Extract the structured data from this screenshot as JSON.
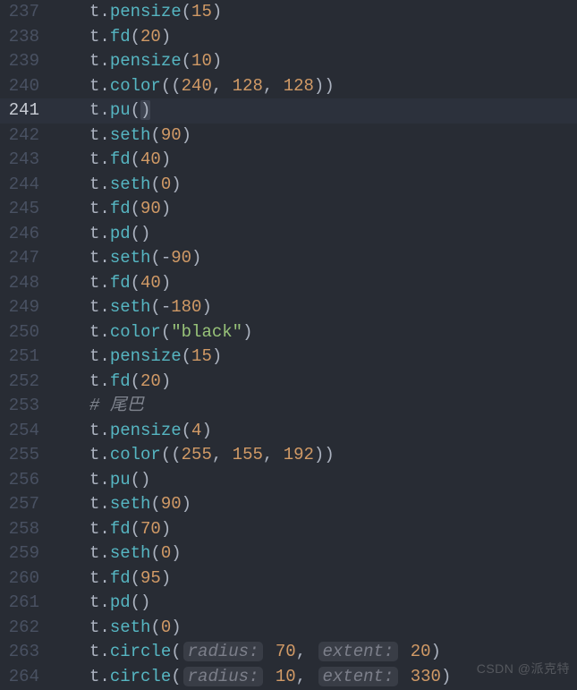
{
  "editor": {
    "watermark": "CSDN @派克特",
    "active_line": 241,
    "lines": [
      {
        "num": 237,
        "tokens": [
          {
            "t": "ident",
            "v": "t"
          },
          {
            "t": "punc",
            "v": "."
          },
          {
            "t": "func",
            "v": "pensize"
          },
          {
            "t": "punc",
            "v": "("
          },
          {
            "t": "num",
            "v": "15"
          },
          {
            "t": "punc",
            "v": ")"
          }
        ]
      },
      {
        "num": 238,
        "tokens": [
          {
            "t": "ident",
            "v": "t"
          },
          {
            "t": "punc",
            "v": "."
          },
          {
            "t": "func",
            "v": "fd"
          },
          {
            "t": "punc",
            "v": "("
          },
          {
            "t": "num",
            "v": "20"
          },
          {
            "t": "punc",
            "v": ")"
          }
        ]
      },
      {
        "num": 239,
        "tokens": [
          {
            "t": "ident",
            "v": "t"
          },
          {
            "t": "punc",
            "v": "."
          },
          {
            "t": "func",
            "v": "pensize"
          },
          {
            "t": "punc",
            "v": "("
          },
          {
            "t": "num",
            "v": "10"
          },
          {
            "t": "punc",
            "v": ")"
          }
        ]
      },
      {
        "num": 240,
        "tokens": [
          {
            "t": "ident",
            "v": "t"
          },
          {
            "t": "punc",
            "v": "."
          },
          {
            "t": "func",
            "v": "color"
          },
          {
            "t": "punc",
            "v": "(("
          },
          {
            "t": "num",
            "v": "240"
          },
          {
            "t": "punc",
            "v": ", "
          },
          {
            "t": "num",
            "v": "128"
          },
          {
            "t": "punc",
            "v": ", "
          },
          {
            "t": "num",
            "v": "128"
          },
          {
            "t": "punc",
            "v": "))"
          }
        ]
      },
      {
        "num": 241,
        "tokens": [
          {
            "t": "ident",
            "v": "t"
          },
          {
            "t": "punc",
            "v": "."
          },
          {
            "t": "func",
            "v": "pu"
          },
          {
            "t": "punc",
            "v": "("
          },
          {
            "t": "punc",
            "v": ")",
            "cursor": true
          }
        ]
      },
      {
        "num": 242,
        "tokens": [
          {
            "t": "ident",
            "v": "t"
          },
          {
            "t": "punc",
            "v": "."
          },
          {
            "t": "func",
            "v": "seth"
          },
          {
            "t": "punc",
            "v": "("
          },
          {
            "t": "num",
            "v": "90"
          },
          {
            "t": "punc",
            "v": ")"
          }
        ]
      },
      {
        "num": 243,
        "tokens": [
          {
            "t": "ident",
            "v": "t"
          },
          {
            "t": "punc",
            "v": "."
          },
          {
            "t": "func",
            "v": "fd"
          },
          {
            "t": "punc",
            "v": "("
          },
          {
            "t": "num",
            "v": "40"
          },
          {
            "t": "punc",
            "v": ")"
          }
        ]
      },
      {
        "num": 244,
        "tokens": [
          {
            "t": "ident",
            "v": "t"
          },
          {
            "t": "punc",
            "v": "."
          },
          {
            "t": "func",
            "v": "seth"
          },
          {
            "t": "punc",
            "v": "("
          },
          {
            "t": "num",
            "v": "0"
          },
          {
            "t": "punc",
            "v": ")"
          }
        ]
      },
      {
        "num": 245,
        "tokens": [
          {
            "t": "ident",
            "v": "t"
          },
          {
            "t": "punc",
            "v": "."
          },
          {
            "t": "func",
            "v": "fd"
          },
          {
            "t": "punc",
            "v": "("
          },
          {
            "t": "num",
            "v": "90"
          },
          {
            "t": "punc",
            "v": ")"
          }
        ]
      },
      {
        "num": 246,
        "tokens": [
          {
            "t": "ident",
            "v": "t"
          },
          {
            "t": "punc",
            "v": "."
          },
          {
            "t": "func",
            "v": "pd"
          },
          {
            "t": "punc",
            "v": "()"
          }
        ]
      },
      {
        "num": 247,
        "tokens": [
          {
            "t": "ident",
            "v": "t"
          },
          {
            "t": "punc",
            "v": "."
          },
          {
            "t": "func",
            "v": "seth"
          },
          {
            "t": "punc",
            "v": "(-"
          },
          {
            "t": "num",
            "v": "90"
          },
          {
            "t": "punc",
            "v": ")"
          }
        ]
      },
      {
        "num": 248,
        "tokens": [
          {
            "t": "ident",
            "v": "t"
          },
          {
            "t": "punc",
            "v": "."
          },
          {
            "t": "func",
            "v": "fd"
          },
          {
            "t": "punc",
            "v": "("
          },
          {
            "t": "num",
            "v": "40"
          },
          {
            "t": "punc",
            "v": ")"
          }
        ]
      },
      {
        "num": 249,
        "tokens": [
          {
            "t": "ident",
            "v": "t"
          },
          {
            "t": "punc",
            "v": "."
          },
          {
            "t": "func",
            "v": "seth"
          },
          {
            "t": "punc",
            "v": "(-"
          },
          {
            "t": "num",
            "v": "180"
          },
          {
            "t": "punc",
            "v": ")"
          }
        ]
      },
      {
        "num": 250,
        "tokens": [
          {
            "t": "ident",
            "v": "t"
          },
          {
            "t": "punc",
            "v": "."
          },
          {
            "t": "func",
            "v": "color"
          },
          {
            "t": "punc",
            "v": "("
          },
          {
            "t": "str",
            "v": "\"black\""
          },
          {
            "t": "punc",
            "v": ")"
          }
        ]
      },
      {
        "num": 251,
        "tokens": [
          {
            "t": "ident",
            "v": "t"
          },
          {
            "t": "punc",
            "v": "."
          },
          {
            "t": "func",
            "v": "pensize"
          },
          {
            "t": "punc",
            "v": "("
          },
          {
            "t": "num",
            "v": "15"
          },
          {
            "t": "punc",
            "v": ")"
          }
        ]
      },
      {
        "num": 252,
        "tokens": [
          {
            "t": "ident",
            "v": "t"
          },
          {
            "t": "punc",
            "v": "."
          },
          {
            "t": "func",
            "v": "fd"
          },
          {
            "t": "punc",
            "v": "("
          },
          {
            "t": "num",
            "v": "20"
          },
          {
            "t": "punc",
            "v": ")"
          }
        ]
      },
      {
        "num": 253,
        "tokens": [
          {
            "t": "cmt",
            "v": "# 尾巴"
          }
        ]
      },
      {
        "num": 254,
        "tokens": [
          {
            "t": "ident",
            "v": "t"
          },
          {
            "t": "punc",
            "v": "."
          },
          {
            "t": "func",
            "v": "pensize"
          },
          {
            "t": "punc",
            "v": "("
          },
          {
            "t": "num",
            "v": "4"
          },
          {
            "t": "punc",
            "v": ")"
          }
        ]
      },
      {
        "num": 255,
        "tokens": [
          {
            "t": "ident",
            "v": "t"
          },
          {
            "t": "punc",
            "v": "."
          },
          {
            "t": "func",
            "v": "color"
          },
          {
            "t": "punc",
            "v": "(("
          },
          {
            "t": "num",
            "v": "255"
          },
          {
            "t": "punc",
            "v": ", "
          },
          {
            "t": "num",
            "v": "155"
          },
          {
            "t": "punc",
            "v": ", "
          },
          {
            "t": "num",
            "v": "192"
          },
          {
            "t": "punc",
            "v": "))"
          }
        ]
      },
      {
        "num": 256,
        "tokens": [
          {
            "t": "ident",
            "v": "t"
          },
          {
            "t": "punc",
            "v": "."
          },
          {
            "t": "func",
            "v": "pu"
          },
          {
            "t": "punc",
            "v": "()"
          }
        ]
      },
      {
        "num": 257,
        "tokens": [
          {
            "t": "ident",
            "v": "t"
          },
          {
            "t": "punc",
            "v": "."
          },
          {
            "t": "func",
            "v": "seth"
          },
          {
            "t": "punc",
            "v": "("
          },
          {
            "t": "num",
            "v": "90"
          },
          {
            "t": "punc",
            "v": ")"
          }
        ]
      },
      {
        "num": 258,
        "tokens": [
          {
            "t": "ident",
            "v": "t"
          },
          {
            "t": "punc",
            "v": "."
          },
          {
            "t": "func",
            "v": "fd"
          },
          {
            "t": "punc",
            "v": "("
          },
          {
            "t": "num",
            "v": "70"
          },
          {
            "t": "punc",
            "v": ")"
          }
        ]
      },
      {
        "num": 259,
        "tokens": [
          {
            "t": "ident",
            "v": "t"
          },
          {
            "t": "punc",
            "v": "."
          },
          {
            "t": "func",
            "v": "seth"
          },
          {
            "t": "punc",
            "v": "("
          },
          {
            "t": "num",
            "v": "0"
          },
          {
            "t": "punc",
            "v": ")"
          }
        ]
      },
      {
        "num": 260,
        "tokens": [
          {
            "t": "ident",
            "v": "t"
          },
          {
            "t": "punc",
            "v": "."
          },
          {
            "t": "func",
            "v": "fd"
          },
          {
            "t": "punc",
            "v": "("
          },
          {
            "t": "num",
            "v": "95"
          },
          {
            "t": "punc",
            "v": ")"
          }
        ]
      },
      {
        "num": 261,
        "tokens": [
          {
            "t": "ident",
            "v": "t"
          },
          {
            "t": "punc",
            "v": "."
          },
          {
            "t": "func",
            "v": "pd"
          },
          {
            "t": "punc",
            "v": "()"
          }
        ]
      },
      {
        "num": 262,
        "tokens": [
          {
            "t": "ident",
            "v": "t"
          },
          {
            "t": "punc",
            "v": "."
          },
          {
            "t": "func",
            "v": "seth"
          },
          {
            "t": "punc",
            "v": "("
          },
          {
            "t": "num",
            "v": "0"
          },
          {
            "t": "punc",
            "v": ")"
          }
        ]
      },
      {
        "num": 263,
        "tokens": [
          {
            "t": "ident",
            "v": "t"
          },
          {
            "t": "punc",
            "v": "."
          },
          {
            "t": "func",
            "v": "circle"
          },
          {
            "t": "punc",
            "v": "("
          },
          {
            "t": "hint",
            "v": "radius:"
          },
          {
            "t": "num",
            "v": "70"
          },
          {
            "t": "punc",
            "v": ", "
          },
          {
            "t": "hint",
            "v": "extent:"
          },
          {
            "t": "num",
            "v": "20"
          },
          {
            "t": "punc",
            "v": ")"
          }
        ]
      },
      {
        "num": 264,
        "tokens": [
          {
            "t": "ident",
            "v": "t"
          },
          {
            "t": "punc",
            "v": "."
          },
          {
            "t": "func",
            "v": "circle"
          },
          {
            "t": "punc",
            "v": "("
          },
          {
            "t": "hint",
            "v": "radius:"
          },
          {
            "t": "num",
            "v": "10"
          },
          {
            "t": "punc",
            "v": ", "
          },
          {
            "t": "hint",
            "v": "extent:"
          },
          {
            "t": "num",
            "v": "330"
          },
          {
            "t": "punc",
            "v": ")"
          }
        ]
      }
    ]
  }
}
